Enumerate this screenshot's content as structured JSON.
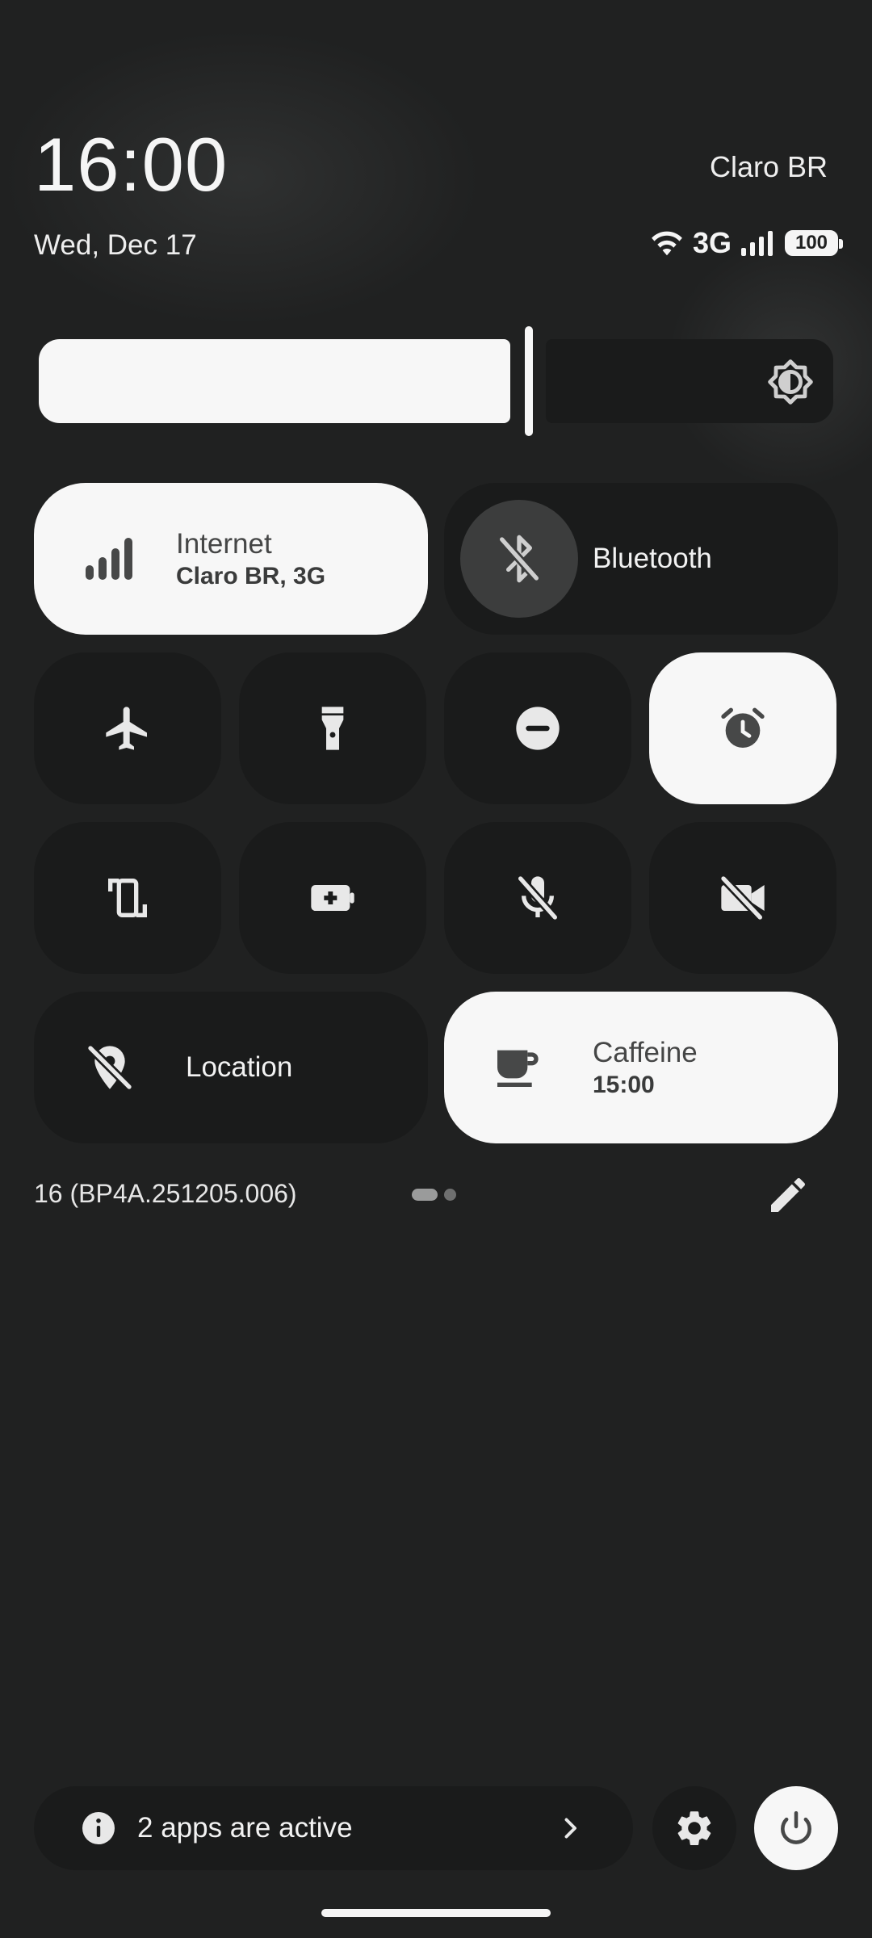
{
  "status": {
    "time": "16:00",
    "date": "Wed, Dec 17",
    "carrier": "Claro BR",
    "network_type": "3G",
    "battery": "100"
  },
  "brightness": {
    "level": 0.61
  },
  "tiles": {
    "internet": {
      "title": "Internet",
      "subtitle": "Claro BR, 3G",
      "icon": "signal-bars-icon",
      "state": "on"
    },
    "bluetooth": {
      "title": "Bluetooth",
      "icon": "bluetooth-off-icon",
      "state": "off"
    },
    "airplane": {
      "icon": "airplane-icon",
      "state": "off"
    },
    "flashlight": {
      "icon": "flashlight-icon",
      "state": "off"
    },
    "dnd": {
      "icon": "do-not-disturb-icon",
      "state": "off"
    },
    "alarm": {
      "icon": "alarm-icon",
      "state": "on"
    },
    "rotate": {
      "icon": "auto-rotate-icon",
      "state": "off"
    },
    "battery_saver": {
      "icon": "battery-saver-icon",
      "state": "off"
    },
    "mic": {
      "icon": "mic-off-icon",
      "state": "off"
    },
    "camera": {
      "icon": "camera-off-icon",
      "state": "off"
    },
    "location": {
      "title": "Location",
      "icon": "location-off-icon",
      "state": "off"
    },
    "caffeine": {
      "title": "Caffeine",
      "subtitle": "15:00",
      "icon": "coffee-icon",
      "state": "on"
    }
  },
  "footer": {
    "build": "16 (BP4A.251205.006)",
    "page_count": 2,
    "current_page": 1
  },
  "bottom": {
    "active_apps": "2 apps are active"
  },
  "colors": {
    "background": "#202121",
    "tile_off": "#1a1b1b",
    "tile_on": "#f7f7f7",
    "icon_on": "#474848"
  }
}
